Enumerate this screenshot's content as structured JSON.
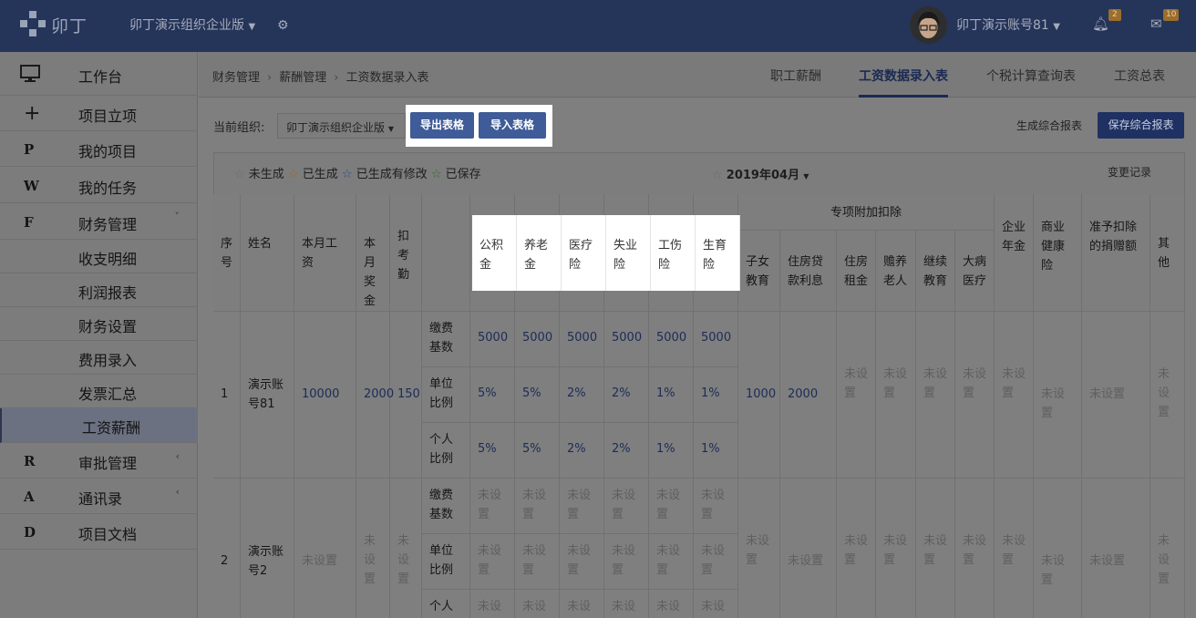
{
  "topbar": {
    "logo": "卯丁",
    "org": "卯丁演示组织企业版",
    "user": "卯丁演示账号81",
    "bell_count": "2",
    "mail_count": "10"
  },
  "sidebar": {
    "items": [
      {
        "icon": "monitor-icon",
        "glyph": "",
        "label": "工作台"
      },
      {
        "icon": "plus-icon",
        "glyph": "+",
        "label": "项目立项"
      },
      {
        "icon": "p-icon",
        "glyph": "P",
        "label": "我的项目"
      },
      {
        "icon": "w-icon",
        "glyph": "W",
        "label": "我的任务"
      },
      {
        "icon": "f-icon",
        "glyph": "F",
        "label": "财务管理",
        "arrow": "˅"
      },
      {
        "label": "收支明细"
      },
      {
        "label": "利润报表"
      },
      {
        "label": "财务设置"
      },
      {
        "label": "费用录入"
      },
      {
        "label": "发票汇总"
      },
      {
        "label": "工资薪酬"
      },
      {
        "icon": "r-icon",
        "glyph": "R",
        "label": "审批管理",
        "arrow": "‹"
      },
      {
        "icon": "a-icon",
        "glyph": "A",
        "label": "通讯录",
        "arrow": "‹"
      },
      {
        "icon": "d-icon",
        "glyph": "D",
        "label": "项目文档"
      }
    ]
  },
  "breadcrumb": [
    "财务管理",
    "薪酬管理",
    "工资数据录入表"
  ],
  "tabs": [
    "职工薪酬",
    "工资数据录入表",
    "个税计算查询表",
    "工资总表"
  ],
  "toolbar": {
    "org_label": "当前组织:",
    "org_value": "卯丁演示组织企业版",
    "export": "导出表格",
    "import": "导入表格",
    "generate": "生成综合报表",
    "save": "保存综合报表"
  },
  "legend": {
    "s1": "☆",
    "t1": "未生成",
    "s2": "☆",
    "t2": "已生成",
    "s3": "☆",
    "t3": "已生成有修改",
    "s4": "☆",
    "t4": "已保存",
    "month_star": "☆",
    "month": "2019年04月",
    "changelog": "变更记录"
  },
  "table": {
    "headers": {
      "seq": "序号",
      "name": "姓名",
      "salary": "本月工资",
      "bonus": "本月奖金",
      "attendance": "扣考勤",
      "gjj": "公积金",
      "ylao": "养老金",
      "yliao": "医疗险",
      "sy": "失业险",
      "gs": "工伤险",
      "syu": "生育险",
      "special": "专项附加扣除",
      "child": "子女教育",
      "loan": "住房贷款利息",
      "rent": "住房租金",
      "elder": "赡养老人",
      "edu": "继续教育",
      "ill": "大病医疗",
      "annuity": "企业年金",
      "health": "商业健康险",
      "donation": "准予扣除的捐赠额",
      "other": "其他"
    },
    "sub": {
      "base": "缴费基数",
      "unit": "单位比例",
      "personal": "个人比例"
    },
    "rows": [
      {
        "seq": "1",
        "name": "演示账号81",
        "salary": "10000",
        "bonus": "2000",
        "attendance": "150",
        "base": [
          "5000",
          "5000",
          "5000",
          "5000",
          "5000",
          "5000"
        ],
        "unit": [
          "5%",
          "5%",
          "2%",
          "2%",
          "1%",
          "1%"
        ],
        "personal": [
          "5%",
          "5%",
          "2%",
          "2%",
          "1%",
          "1%"
        ],
        "child": "1000",
        "loan": "2000",
        "rent": "未设置",
        "elder": "未设置",
        "edu": "未设置",
        "ill": "未设置",
        "annuity": "未设置",
        "health": "未设置",
        "donation": "未设置",
        "other": "未设置"
      },
      {
        "seq": "2",
        "name": "演示账号2",
        "salary": "未设置",
        "bonus": "未设置",
        "attendance": "未设置",
        "base": [
          "未设置",
          "未设置",
          "未设置",
          "未设置",
          "未设置",
          "未设置"
        ],
        "unit": [
          "未设置",
          "未设置",
          "未设置",
          "未设置",
          "未设置",
          "未设置"
        ],
        "personal": [
          "未设",
          "未设",
          "未设",
          "未设",
          "未设",
          "未设"
        ],
        "child": "未设置",
        "loan": "未设置",
        "rent": "未设置",
        "elder": "未设置",
        "edu": "未设置",
        "ill": "未设置",
        "annuity": "未设置",
        "health": "未设置",
        "donation": "未设置",
        "other": "未设置"
      }
    ]
  }
}
